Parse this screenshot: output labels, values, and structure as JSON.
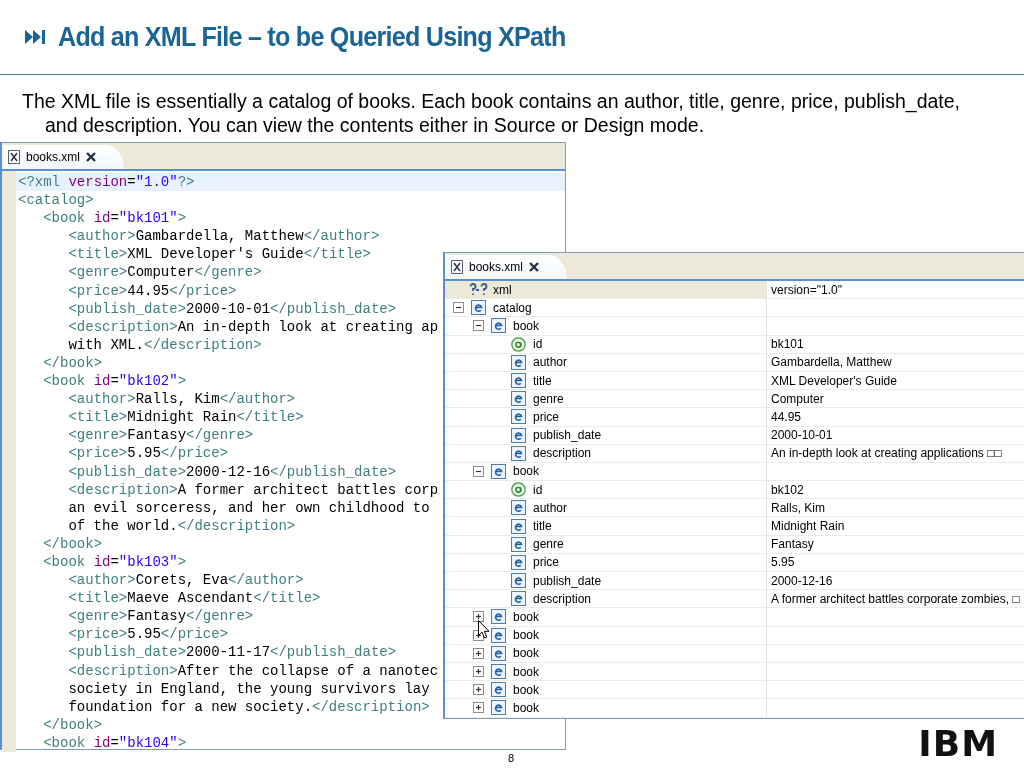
{
  "slide": {
    "title": "Add an XML File – to be Queried Using XPath",
    "body": "The XML file is essentially a catalog of books.  Each book contains an author, title, genre, price, publish_date, and description. You can view the contents either in Source or Design mode.",
    "page_number": "8",
    "logo": "IBM"
  },
  "source_editor": {
    "tab": {
      "label": "books.xml"
    },
    "lines": [
      "<?xml version=\"1.0\"?>",
      "<catalog>",
      "   <book id=\"bk101\">",
      "      <author>Gambardella, Matthew</author>",
      "      <title>XML Developer's Guide</title>",
      "      <genre>Computer</genre>",
      "      <price>44.95</price>",
      "      <publish_date>2000-10-01</publish_date>",
      "      <description>An in-depth look at creating ap",
      "      with XML.</description>",
      "   </book>",
      "   <book id=\"bk102\">",
      "      <author>Ralls, Kim</author>",
      "      <title>Midnight Rain</title>",
      "      <genre>Fantasy</genre>",
      "      <price>5.95</price>",
      "      <publish_date>2000-12-16</publish_date>",
      "      <description>A former architect battles corp",
      "      an evil sorceress, and her own childhood to",
      "      of the world.</description>",
      "   </book>",
      "   <book id=\"bk103\">",
      "      <author>Corets, Eva</author>",
      "      <title>Maeve Ascendant</title>",
      "      <genre>Fantasy</genre>",
      "      <price>5.95</price>",
      "      <publish_date>2000-11-17</publish_date>",
      "      <description>After the collapse of a nanotec",
      "      society in England, the young survivors lay",
      "      foundation for a new society.</description>",
      "   </book>",
      "   <book id=\"bk104\">"
    ]
  },
  "design_editor": {
    "tab": {
      "label": "books.xml"
    },
    "tree": [
      {
        "kind": "instruction",
        "name": "xml",
        "value": "version=\"1.0\""
      },
      {
        "kind": "element",
        "name": "catalog",
        "expanded": true,
        "children": [
          {
            "kind": "element",
            "name": "book",
            "expanded": true,
            "children": [
              {
                "kind": "attribute",
                "name": "id",
                "value": "bk101"
              },
              {
                "kind": "element",
                "name": "author",
                "value": "Gambardella, Matthew"
              },
              {
                "kind": "element",
                "name": "title",
                "value": "XML Developer's Guide"
              },
              {
                "kind": "element",
                "name": "genre",
                "value": "Computer"
              },
              {
                "kind": "element",
                "name": "price",
                "value": "44.95"
              },
              {
                "kind": "element",
                "name": "publish_date",
                "value": "2000-10-01"
              },
              {
                "kind": "element",
                "name": "description",
                "value": "An in-depth look at creating applications □□"
              }
            ]
          },
          {
            "kind": "element",
            "name": "book",
            "expanded": true,
            "children": [
              {
                "kind": "attribute",
                "name": "id",
                "value": "bk102"
              },
              {
                "kind": "element",
                "name": "author",
                "value": "Ralls, Kim"
              },
              {
                "kind": "element",
                "name": "title",
                "value": "Midnight Rain"
              },
              {
                "kind": "element",
                "name": "genre",
                "value": "Fantasy"
              },
              {
                "kind": "element",
                "name": "price",
                "value": "5.95"
              },
              {
                "kind": "element",
                "name": "publish_date",
                "value": "2000-12-16"
              },
              {
                "kind": "element",
                "name": "description",
                "value": "A former architect battles corporate zombies, □"
              }
            ]
          },
          {
            "kind": "element",
            "name": "book",
            "expanded": false
          },
          {
            "kind": "element",
            "name": "book",
            "expanded": false
          },
          {
            "kind": "element",
            "name": "book",
            "expanded": false
          },
          {
            "kind": "element",
            "name": "book",
            "expanded": false
          },
          {
            "kind": "element",
            "name": "book",
            "expanded": false
          },
          {
            "kind": "element",
            "name": "book",
            "expanded": false
          }
        ]
      }
    ]
  }
}
